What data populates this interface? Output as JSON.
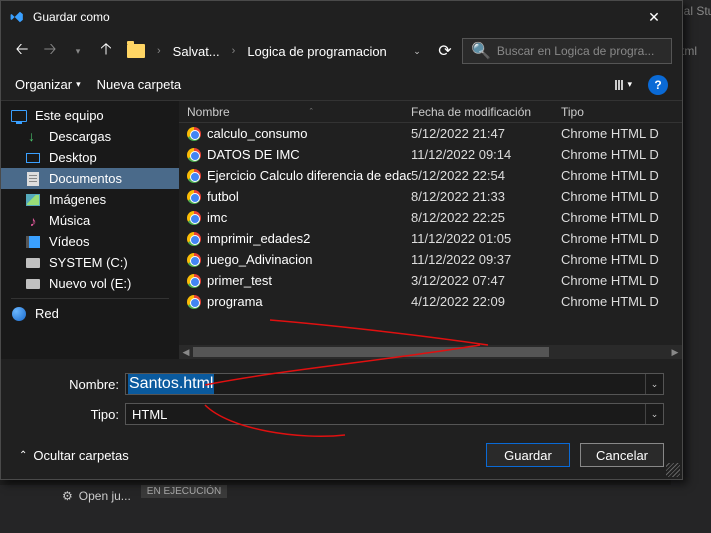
{
  "bg": {
    "vs_text": "sual Stu",
    "tab_text": ".html"
  },
  "dialog": {
    "title": "Guardar como",
    "crumbs": {
      "c1": "Salvat...",
      "c2": "Logica de programacion"
    },
    "search_placeholder": "Buscar en Logica de progra...",
    "toolbar": {
      "organize": "Organizar",
      "newfolder": "Nueva carpeta"
    }
  },
  "sidebar": {
    "root": "Este equipo",
    "items": [
      {
        "label": "Descargas"
      },
      {
        "label": "Desktop"
      },
      {
        "label": "Documentos"
      },
      {
        "label": "Imágenes"
      },
      {
        "label": "Música"
      },
      {
        "label": "Vídeos"
      },
      {
        "label": "SYSTEM (C:)"
      },
      {
        "label": "Nuevo vol (E:)"
      }
    ],
    "network": "Red"
  },
  "columns": {
    "name": "Nombre",
    "date": "Fecha de modificación",
    "type": "Tipo"
  },
  "files": [
    {
      "name": "calculo_consumo",
      "date": "5/12/2022 21:47",
      "type": "Chrome HTML D"
    },
    {
      "name": "DATOS DE IMC",
      "date": "11/12/2022 09:14",
      "type": "Chrome HTML D"
    },
    {
      "name": "Ejercicio Calculo diferencia de edades",
      "date": "5/12/2022 22:54",
      "type": "Chrome HTML D"
    },
    {
      "name": "futbol",
      "date": "8/12/2022 21:33",
      "type": "Chrome HTML D"
    },
    {
      "name": "imc",
      "date": "8/12/2022 22:25",
      "type": "Chrome HTML D"
    },
    {
      "name": "imprimir_edades2",
      "date": "11/12/2022 01:05",
      "type": "Chrome HTML D"
    },
    {
      "name": "juego_Adivinacion",
      "date": "11/12/2022 09:37",
      "type": "Chrome HTML D"
    },
    {
      "name": "primer_test",
      "date": "3/12/2022 07:47",
      "type": "Chrome HTML D"
    },
    {
      "name": "programa",
      "date": "4/12/2022 22:09",
      "type": "Chrome HTML D"
    }
  ],
  "form": {
    "name_label": "Nombre:",
    "name_value": "Santos.html",
    "type_label": "Tipo:",
    "type_value": "HTML",
    "hide": "Ocultar carpetas",
    "save": "Guardar",
    "cancel": "Cancelar"
  },
  "strip": {
    "open": "Open ju...",
    "running": "EN EJECUCIÓN"
  }
}
